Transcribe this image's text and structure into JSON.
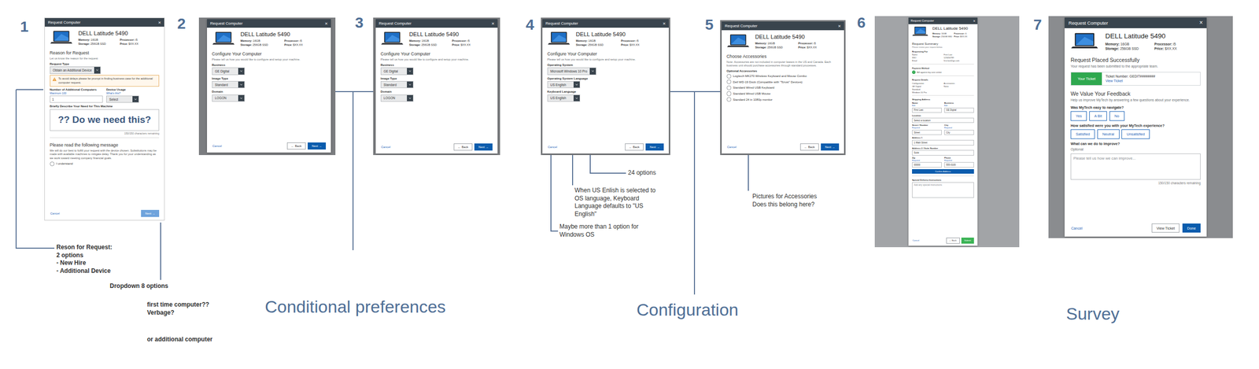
{
  "screens": [
    {
      "number": "1",
      "dialog": {
        "title": "Request Computer",
        "close": "×",
        "product": {
          "name": "DELL Latitude 5490",
          "specs": [
            {
              "label": "Memory:",
              "value": "16GB"
            },
            {
              "label": "Processor:",
              "value": "i5"
            },
            {
              "label": "Storage:",
              "value": "256GB SSD"
            },
            {
              "label": "Price:",
              "value": "$XX.XX"
            }
          ]
        },
        "items": [
          {
            "kind": "heading",
            "text": "Reason for Request"
          },
          {
            "kind": "sub",
            "text": "Let us know the reason for the request"
          },
          {
            "kind": "label",
            "text": "Request Type"
          },
          {
            "kind": "select",
            "value": "Obtain an Additional Device"
          },
          {
            "kind": "warning",
            "text": "To avoid delays please be prompt in finding business case for the additional computer request."
          },
          {
            "kind": "fields",
            "fields": [
              {
                "label": "Number of Additional Computers",
                "hint": "Maximum 100",
                "kind": "input",
                "value": "1"
              },
              {
                "label": "Device Usage",
                "hint": "What's this?",
                "kind": "select",
                "value": "Select"
              }
            ]
          },
          {
            "kind": "label",
            "text": "Briefly Describe Your Need for This Machine"
          },
          {
            "kind": "textarea",
            "overlay": "?? Do we need this?"
          },
          {
            "kind": "counter",
            "text": "150/150 characters remaining"
          },
          {
            "kind": "divider"
          },
          {
            "kind": "heading",
            "text": "Please read the following message"
          },
          {
            "kind": "paragraph",
            "text": "We will do our best to fulfill your request with the device chosen. Substitutions may be made with available machines to mitigate delay. Thank you for your understanding as we work toward meeting company financial goals."
          },
          {
            "kind": "checkbox",
            "label": "I understand",
            "checked": false
          }
        ],
        "buttons": [
          {
            "label": "Cancel",
            "kind": "link",
            "disabled": false
          },
          {
            "label": "Next →",
            "kind": "primary",
            "disabled": true
          }
        ]
      }
    },
    {
      "number": "2",
      "dialog": {
        "title": "Request Computer",
        "close": "×",
        "product": {
          "name": "DELL Latitude 5490",
          "specs": [
            {
              "label": "Memory:",
              "value": "16GB"
            },
            {
              "label": "Processor:",
              "value": "i5"
            },
            {
              "label": "Storage:",
              "value": "256GB SSD"
            },
            {
              "label": "Price:",
              "value": "$XX.XX"
            }
          ]
        },
        "items": [
          {
            "kind": "heading",
            "text": "Configure Your Computer"
          },
          {
            "kind": "sub",
            "text": "Please tell us how you would like to configure and setup your machine."
          },
          {
            "kind": "label",
            "text": "Business"
          },
          {
            "kind": "select",
            "value": "GE Digital"
          },
          {
            "kind": "label",
            "text": "Image Type"
          },
          {
            "kind": "select",
            "value": "Standard"
          },
          {
            "kind": "label",
            "text": "Domain"
          },
          {
            "kind": "select",
            "value": "LOGON"
          }
        ],
        "buttons": [
          {
            "label": "Cancel",
            "kind": "link",
            "disabled": false
          },
          {
            "label": "← Back",
            "kind": "secondary",
            "disabled": false
          },
          {
            "label": "Next →",
            "kind": "primary",
            "disabled": false
          }
        ]
      }
    },
    {
      "number": "3",
      "dialog": {
        "title": "Request Computer",
        "close": "×",
        "product": {
          "name": "DELL Latitude 5490",
          "specs": [
            {
              "label": "Memory:",
              "value": "16GB"
            },
            {
              "label": "Processor:",
              "value": "i5"
            },
            {
              "label": "Storage:",
              "value": "256GB SSD"
            },
            {
              "label": "Price:",
              "value": "$XX.XX"
            }
          ]
        },
        "items": [
          {
            "kind": "heading",
            "text": "Configure Your Computer"
          },
          {
            "kind": "sub",
            "text": "Please tell us how you would like to configure and setup your machine."
          },
          {
            "kind": "label",
            "text": "Business"
          },
          {
            "kind": "select",
            "value": "GE Digital"
          },
          {
            "kind": "label",
            "text": "Image Type"
          },
          {
            "kind": "select",
            "value": "Standard"
          },
          {
            "kind": "label",
            "text": "Domain"
          },
          {
            "kind": "select",
            "value": "LOGON"
          }
        ],
        "buttons": [
          {
            "label": "Cancel",
            "kind": "link",
            "disabled": false
          },
          {
            "label": "← Back",
            "kind": "secondary",
            "disabled": false
          },
          {
            "label": "Next →",
            "kind": "primary",
            "disabled": false
          }
        ]
      }
    },
    {
      "number": "4",
      "dialog": {
        "title": "Request Computer",
        "close": "×",
        "product": {
          "name": "DELL Latitude 5490",
          "specs": [
            {
              "label": "Memory:",
              "value": "16GB"
            },
            {
              "label": "Processor:",
              "value": "i5"
            },
            {
              "label": "Storage:",
              "value": "256GB SSD"
            },
            {
              "label": "Price:",
              "value": "$XX.XX"
            }
          ]
        },
        "items": [
          {
            "kind": "heading",
            "text": "Configure Your Computer"
          },
          {
            "kind": "sub",
            "text": "Please tell us how you would like to configure and setup your machine."
          },
          {
            "kind": "label",
            "text": "Operating System"
          },
          {
            "kind": "select",
            "value": "Microsoft Windows 10 Pro"
          },
          {
            "kind": "label",
            "text": "Operating System Language"
          },
          {
            "kind": "select",
            "value": "US English"
          },
          {
            "kind": "label",
            "text": "Keyboard Language"
          },
          {
            "kind": "select",
            "value": "US English"
          }
        ],
        "buttons": [
          {
            "label": "Cancel",
            "kind": "link",
            "disabled": false
          },
          {
            "label": "← Back",
            "kind": "secondary",
            "disabled": false
          },
          {
            "label": "Next →",
            "kind": "primary",
            "disabled": false
          }
        ]
      }
    },
    {
      "number": "5",
      "dialog": {
        "title": "Request Computer",
        "close": "×",
        "product": {
          "name": "DELL Latitude 5490",
          "specs": [
            {
              "label": "Memory:",
              "value": "16GB"
            },
            {
              "label": "Processor:",
              "value": "i5"
            },
            {
              "label": "Storage:",
              "value": "256GB SSD"
            },
            {
              "label": "Price:",
              "value": "$XX.XX"
            }
          ]
        },
        "items": [
          {
            "kind": "heading",
            "text": "Choose Accessories"
          },
          {
            "kind": "sub",
            "text": "Note: Accessories are not included in computer leases in the US and Canada. Each business unit should purchase accessories through standard processes."
          },
          {
            "kind": "label",
            "text": "Optional Accessories"
          },
          {
            "kind": "checkbox",
            "label": "Logitech MK270 Wireless Keyboard and Mouse Combo",
            "checked": false
          },
          {
            "kind": "checkbox",
            "label": "Dell WD-19 Dock (Compatible with \"Tcrust\" Devices)",
            "checked": false
          },
          {
            "kind": "checkbox",
            "label": "Standard Wired USB Keyboard",
            "checked": false
          },
          {
            "kind": "checkbox",
            "label": "Standard Wired USB Mouse",
            "checked": false
          },
          {
            "kind": "checkbox",
            "label": "Standard 24 in 1080p monitor",
            "checked": false
          }
        ],
        "buttons": [
          {
            "label": "Cancel",
            "kind": "link",
            "disabled": false
          },
          {
            "label": "← Back",
            "kind": "secondary",
            "disabled": false
          },
          {
            "label": "Next →",
            "kind": "primary",
            "disabled": false
          }
        ]
      }
    },
    {
      "number": "6",
      "dialog": {
        "title": "Request Computer",
        "close": "×",
        "product": {
          "name": "DELL Latitude 5490",
          "specs": [
            {
              "label": "Memory:",
              "value": "16GB"
            },
            {
              "label": "Processor:",
              "value": "i5"
            },
            {
              "label": "Storage:",
              "value": "256GB SSD"
            },
            {
              "label": "Price:",
              "value": "$XX.XX"
            }
          ]
        },
        "items": [
          {
            "kind": "heading",
            "text": "Request Summary"
          },
          {
            "kind": "sub",
            "text": "Please review your request below."
          },
          {
            "kind": "label",
            "text": "Requesting For"
          },
          {
            "kind": "summary",
            "rows": [
              {
                "label": "Name",
                "value": "First Last"
              },
              {
                "label": "SSO",
                "value": "123456789"
              },
              {
                "label": "Email",
                "value": "first.last@ge.com"
              }
            ]
          },
          {
            "kind": "divider"
          },
          {
            "kind": "label",
            "text": "Payment Method"
          },
          {
            "kind": "checkbox",
            "label": "Bill against my cost center",
            "checked": true
          },
          {
            "kind": "divider"
          },
          {
            "kind": "label",
            "text": "Request Details"
          },
          {
            "kind": "summary",
            "rows": [
              {
                "label": "Configuration",
                "value": "Accessories"
              },
              {
                "label": "GE Digital",
                "value": "None"
              },
              {
                "label": "Standard",
                "value": ""
              },
              {
                "label": "Windows 10 Pro",
                "value": ""
              }
            ]
          },
          {
            "kind": "divider"
          },
          {
            "kind": "label",
            "text": "Shipping Address"
          },
          {
            "kind": "fields",
            "fields": [
              {
                "label": "Name",
                "hint": "Edit",
                "kind": "input",
                "value": "First Last"
              },
              {
                "label": "Business",
                "hint": "Edit",
                "kind": "input",
                "value": "GE Digital"
              }
            ]
          },
          {
            "kind": "label",
            "text": "Location"
          },
          {
            "kind": "input",
            "value": "Select a location"
          },
          {
            "kind": "fields",
            "fields": [
              {
                "label": "Street / Number",
                "hint": "Required",
                "kind": "input",
                "value": "Street"
              },
              {
                "label": "City",
                "hint": "Required",
                "kind": "input",
                "value": "City"
              }
            ]
          },
          {
            "kind": "label",
            "text": "Address 1"
          },
          {
            "kind": "input",
            "value": "1 Main Street"
          },
          {
            "kind": "label",
            "text": "Address 2 / Suite Number"
          },
          {
            "kind": "input",
            "value": "Suite"
          },
          {
            "kind": "fields",
            "fields": [
              {
                "label": "Zip",
                "hint": "Required",
                "kind": "input",
                "value": "00000"
              },
              {
                "label": "Phone",
                "hint": "Required",
                "kind": "input",
                "value": "555-0100"
              }
            ]
          },
          {
            "kind": "wide-button",
            "label": "Confirm Address"
          },
          {
            "kind": "divider"
          },
          {
            "kind": "label",
            "text": "Special Delivery Instructions"
          },
          {
            "kind": "textarea",
            "placeholder": "Add any special instructions"
          }
        ],
        "buttons": [
          {
            "label": "Cancel",
            "kind": "link",
            "disabled": false
          },
          {
            "label": "← Back",
            "kind": "secondary",
            "disabled": false
          },
          {
            "label": "Submit",
            "kind": "success",
            "disabled": false
          }
        ]
      }
    },
    {
      "number": "7",
      "dialog": {
        "title": "Request Computer",
        "close": "×",
        "product": {
          "name": "DELL Latitude 5490",
          "specs": [
            {
              "label": "Memory:",
              "value": "16GB"
            },
            {
              "label": "Processor:",
              "value": "i5"
            },
            {
              "label": "Storage:",
              "value": "256GB SSD"
            },
            {
              "label": "Price:",
              "value": "$XX.XX"
            }
          ]
        },
        "items": [
          {
            "kind": "heading",
            "text": "Request Placed Successfully"
          },
          {
            "kind": "sub",
            "text": "Your request has been submitted to the appropriate team."
          },
          {
            "kind": "ticket",
            "badge": "Your Ticket",
            "number": "Ticket Number: GEDIT########",
            "link": "View Ticket"
          },
          {
            "kind": "heading",
            "text": "We Value Your Feedback"
          },
          {
            "kind": "sub",
            "text": "Help us improve MyTech by answering a few questions about your experience."
          },
          {
            "kind": "label",
            "text": "Was MyTech easy to navigate?"
          },
          {
            "kind": "choices",
            "options": [
              {
                "label": "Yes",
                "selected": false
              },
              {
                "label": "A Bit",
                "selected": false
              },
              {
                "label": "No",
                "selected": false
              }
            ]
          },
          {
            "kind": "label",
            "text": "How satisfied were you with your MyTech experience?"
          },
          {
            "kind": "choices",
            "options": [
              {
                "label": "Satisfied",
                "selected": false
              },
              {
                "label": "Neutral",
                "selected": false
              },
              {
                "label": "Unsatisfied",
                "selected": false
              }
            ]
          },
          {
            "kind": "label",
            "text": "What can we do to improve?"
          },
          {
            "kind": "sub",
            "text": "Optional"
          },
          {
            "kind": "textarea",
            "placeholder": "Please tell us how we can improve..."
          },
          {
            "kind": "counter",
            "text": "150/150 characters remaining"
          }
        ],
        "buttons": [
          {
            "label": "Cancel",
            "kind": "link",
            "disabled": false
          },
          {
            "label": "View Ticket",
            "kind": "secondary",
            "disabled": false
          },
          {
            "label": "Done",
            "kind": "primary",
            "disabled": false
          }
        ]
      }
    }
  ],
  "notes": [
    {
      "lines": [
        "Reson for Request:",
        "2 options",
        "- New Hire",
        "- Additional Device"
      ],
      "kind": "bold"
    },
    {
      "lines": [
        "Dropdown 8 options"
      ],
      "kind": "bold"
    },
    {
      "lines": [
        "first time computer??",
        "Verbage?"
      ],
      "kind": "bold"
    },
    {
      "lines": [
        "or additional computer"
      ],
      "kind": "bold"
    },
    {
      "lines": [
        "24 options"
      ],
      "kind": "plain"
    },
    {
      "lines": [
        "When US Enlish is selected to",
        "OS language, Keyboard",
        "Language defaults to \"US",
        "English\""
      ],
      "kind": "plain"
    },
    {
      "lines": [
        "Maybe more than  1 option for",
        "Windows OS"
      ],
      "kind": "plain"
    },
    {
      "lines": [
        "Pictures for Accessories",
        "Does this belong here?"
      ],
      "kind": "plain"
    }
  ],
  "sections": [
    {
      "label": "Conditional preferences"
    },
    {
      "label": "Configuration"
    },
    {
      "label": "Survey"
    }
  ]
}
